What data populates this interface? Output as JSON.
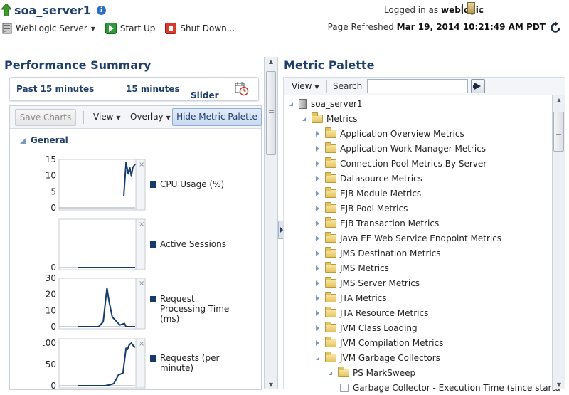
{
  "header": {
    "server_name": "soa_server1",
    "logged_in_label": "Logged in as",
    "username": "weblogic",
    "page_refreshed_label": "Page Refreshed",
    "page_refreshed_time": "Mar 19, 2014 10:21:49 AM PDT"
  },
  "toolbar": {
    "weblogic_menu": "WebLogic Server",
    "start_up": "Start Up",
    "shut_down": "Shut Down..."
  },
  "performance": {
    "title": "Performance Summary",
    "time_range_label": "Past 15 minutes",
    "duration": "15 minutes",
    "slider": "Slider",
    "save_charts": "Save Charts",
    "view": "View",
    "overlay": "Overlay",
    "hide_metric_palette": "Hide Metric Palette",
    "general": "General"
  },
  "chart_data": [
    {
      "type": "line",
      "series": [
        {
          "name": "CPU Usage (%)",
          "values": [
            [
              0.85,
              3.5
            ],
            [
              0.88,
              14
            ],
            [
              0.91,
              10.5
            ],
            [
              0.93,
              12.5
            ],
            [
              0.95,
              10
            ],
            [
              0.97,
              12.5
            ],
            [
              1.0,
              13.5
            ]
          ]
        }
      ],
      "yticks": [
        "15",
        "10",
        "5",
        "0"
      ],
      "ylim": [
        0,
        15
      ]
    },
    {
      "type": "line",
      "series": [
        {
          "name": "Active Sessions",
          "values": [
            [
              0.25,
              0
            ],
            [
              1.0,
              0
            ]
          ]
        }
      ],
      "yticks": [
        "0"
      ],
      "ylim": [
        0,
        1
      ]
    },
    {
      "type": "line",
      "series": [
        {
          "name": "Request Processing Time (ms)",
          "values": [
            [
              0.25,
              0
            ],
            [
              0.52,
              0
            ],
            [
              0.58,
              3
            ],
            [
              0.63,
              24
            ],
            [
              0.66,
              15
            ],
            [
              0.7,
              6
            ],
            [
              0.76,
              3
            ],
            [
              0.8,
              1
            ],
            [
              0.86,
              2
            ],
            [
              0.88,
              0
            ],
            [
              1.0,
              0
            ]
          ]
        }
      ],
      "yticks": [
        "30",
        "20",
        "10",
        "0"
      ],
      "ylim": [
        0,
        30
      ]
    },
    {
      "type": "line",
      "series": [
        {
          "name": "Requests (per minute)",
          "values": [
            [
              0.25,
              0
            ],
            [
              0.6,
              0
            ],
            [
              0.66,
              2
            ],
            [
              0.72,
              5
            ],
            [
              0.78,
              25
            ],
            [
              0.84,
              30
            ],
            [
              0.88,
              88
            ],
            [
              0.9,
              85
            ],
            [
              0.92,
              95
            ],
            [
              0.95,
              100
            ],
            [
              0.98,
              93
            ],
            [
              1.0,
              90
            ]
          ]
        }
      ],
      "yticks": [
        "100",
        "50",
        "0"
      ],
      "ylim": [
        0,
        110
      ]
    }
  ],
  "palette": {
    "title": "Metric Palette",
    "view": "View",
    "search_label": "Search",
    "search_value": "",
    "tree": [
      {
        "label": "soa_server1",
        "kind": "server",
        "expand": "down"
      },
      {
        "label": "Metrics",
        "kind": "folder",
        "expand": "down"
      },
      {
        "label": "Application Overview Metrics",
        "kind": "folder",
        "expand": "right"
      },
      {
        "label": "Application Work Manager Metrics",
        "kind": "folder",
        "expand": "right"
      },
      {
        "label": "Connection Pool Metrics By Server",
        "kind": "folder",
        "expand": "right"
      },
      {
        "label": "Datasource Metrics",
        "kind": "folder",
        "expand": "right"
      },
      {
        "label": "EJB Module Metrics",
        "kind": "folder",
        "expand": "right"
      },
      {
        "label": "EJB Pool Metrics",
        "kind": "folder",
        "expand": "right"
      },
      {
        "label": "EJB Transaction Metrics",
        "kind": "folder",
        "expand": "right"
      },
      {
        "label": "Java EE Web Service Endpoint Metrics",
        "kind": "folder",
        "expand": "right"
      },
      {
        "label": "JMS Destination Metrics",
        "kind": "folder",
        "expand": "right"
      },
      {
        "label": "JMS Metrics",
        "kind": "folder",
        "expand": "right"
      },
      {
        "label": "JMS Server Metrics",
        "kind": "folder",
        "expand": "right"
      },
      {
        "label": "JTA Metrics",
        "kind": "folder",
        "expand": "right"
      },
      {
        "label": "JTA Resource Metrics",
        "kind": "folder",
        "expand": "right"
      },
      {
        "label": "JVM Class Loading",
        "kind": "folder",
        "expand": "right"
      },
      {
        "label": "JVM Compilation Metrics",
        "kind": "folder",
        "expand": "right"
      },
      {
        "label": "JVM Garbage Collectors",
        "kind": "folder",
        "expand": "down"
      },
      {
        "label": "PS MarkSweep",
        "kind": "folder",
        "expand": "down"
      },
      {
        "label": "Garbage Collector - Execution Time (since startu",
        "kind": "checkbox",
        "expand": "none"
      }
    ]
  }
}
